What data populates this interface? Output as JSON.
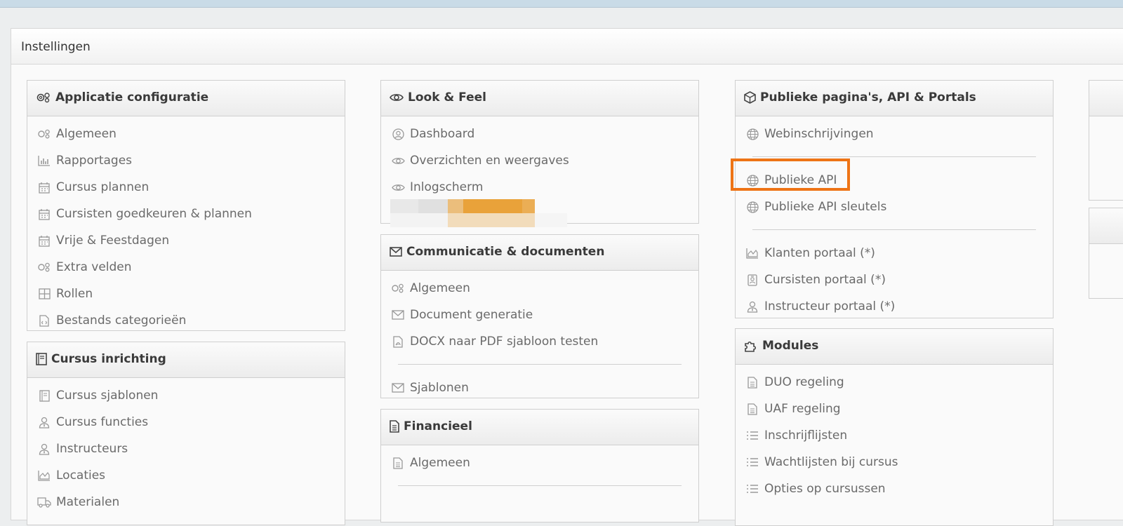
{
  "window": {
    "title": "Instellingen"
  },
  "panels": {
    "applicatie": {
      "title": "Applicatie configuratie",
      "items": [
        {
          "label": "Algemeen",
          "icon": "gears-icon"
        },
        {
          "label": "Rapportages",
          "icon": "bar-chart-icon"
        },
        {
          "label": "Cursus plannen",
          "icon": "calendar-icon"
        },
        {
          "label": "Cursisten goedkeuren & plannen",
          "icon": "calendar-icon"
        },
        {
          "label": "Vrije & Feestdagen",
          "icon": "calendar-icon"
        },
        {
          "label": "Extra velden",
          "icon": "gears-icon"
        },
        {
          "label": "Rollen",
          "icon": "grid-icon"
        },
        {
          "label": "Bestands categorieën",
          "icon": "file-code-icon"
        }
      ]
    },
    "cursus_inrichting": {
      "title": "Cursus inrichting",
      "items": [
        {
          "label": "Cursus sjablonen",
          "icon": "book-icon"
        },
        {
          "label": "Cursus functies",
          "icon": "user-tie-icon"
        },
        {
          "label": "Instructeurs",
          "icon": "user-tie-icon"
        },
        {
          "label": "Locaties",
          "icon": "area-chart-icon"
        },
        {
          "label": "Materialen",
          "icon": "truck-icon"
        }
      ]
    },
    "look_feel": {
      "title": "Look & Feel",
      "items": [
        {
          "label": "Dashboard",
          "icon": "user-circle-icon"
        },
        {
          "label": "Overzichten en weergaves",
          "icon": "eye-icon"
        },
        {
          "label": "Inlogscherm",
          "icon": "eye-icon"
        }
      ]
    },
    "communicatie": {
      "title": "Communicatie & documenten",
      "items": [
        {
          "label": "Algemeen",
          "icon": "gears-icon"
        },
        {
          "label": "Document generatie",
          "icon": "envelope-icon"
        },
        {
          "label": "DOCX naar PDF sjabloon testen",
          "icon": "file-pdf-icon"
        },
        {
          "label": "Sjablonen",
          "icon": "envelope-icon"
        }
      ]
    },
    "financieel": {
      "title": "Financieel",
      "items": [
        {
          "label": "Algemeen",
          "icon": "file-text-icon"
        }
      ]
    },
    "publieke": {
      "title": "Publieke pagina's, API & Portals",
      "items": [
        {
          "label": "Webinschrijvingen",
          "icon": "globe-icon"
        },
        {
          "label": "Publieke API",
          "icon": "globe-icon"
        },
        {
          "label": "Publieke API sleutels",
          "icon": "globe-icon"
        },
        {
          "label": "Klanten portaal (*)",
          "icon": "area-chart-icon"
        },
        {
          "label": "Cursisten portaal (*)",
          "icon": "id-badge-icon"
        },
        {
          "label": "Instructeur portaal (*)",
          "icon": "user-tie-icon"
        }
      ]
    },
    "modules": {
      "title": "Modules",
      "items": [
        {
          "label": "DUO regeling",
          "icon": "file-text-icon"
        },
        {
          "label": "UAF regeling",
          "icon": "file-text-icon"
        },
        {
          "label": "Inschrijflijsten",
          "icon": "list-icon"
        },
        {
          "label": "Wachtlijsten bij cursus",
          "icon": "list-icon"
        },
        {
          "label": "Opties op cursussen",
          "icon": "list-icon"
        }
      ]
    }
  },
  "colors": {
    "highlight": "#ee7416",
    "redaction": "#e9a23a"
  }
}
